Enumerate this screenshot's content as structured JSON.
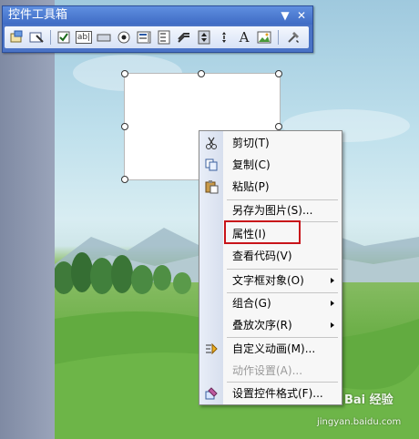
{
  "toolbox": {
    "title": "控件工具箱",
    "tools": [
      "view-code-icon",
      "design-mode-icon",
      "checkbox-icon",
      "textbox-icon",
      "command-button-icon",
      "option-button-icon",
      "listbox-icon",
      "combobox-icon",
      "toggle-button-icon",
      "spin-button-icon",
      "scrollbar-icon",
      "label-icon",
      "image-icon",
      "more-controls-icon"
    ],
    "label_glyph": "A",
    "textbox_glyph": "ab|"
  },
  "context_menu": {
    "items": [
      {
        "label": "剪切(T)",
        "icon": "scissors-icon"
      },
      {
        "label": "复制(C)",
        "icon": "copy-icon"
      },
      {
        "label": "粘贴(P)",
        "icon": "paste-icon"
      },
      {
        "label": "另存为图片(S)..."
      },
      {
        "label": "属性(I)"
      },
      {
        "label": "查看代码(V)"
      },
      {
        "label": "文字框对象(O)",
        "submenu": true
      },
      {
        "label": "组合(G)",
        "submenu": true
      },
      {
        "label": "叠放次序(R)",
        "submenu": true
      },
      {
        "label": "自定义动画(M)...",
        "icon": "custom-animation-icon"
      },
      {
        "label": "动作设置(A)...",
        "disabled": true
      },
      {
        "label": "设置控件格式(F)...",
        "icon": "format-control-icon"
      }
    ]
  },
  "watermark": {
    "text": "Bai 经验",
    "sub": "jingyan.baidu.com"
  },
  "colors": {
    "highlight": "#c8141a",
    "toolbox_bg": "#4a73c6"
  }
}
